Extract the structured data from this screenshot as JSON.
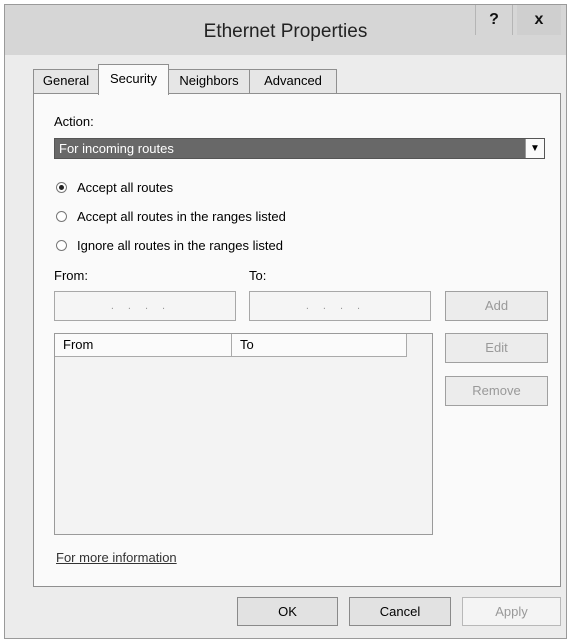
{
  "window": {
    "title": "Ethernet Properties",
    "help_glyph": "?",
    "close_glyph": "x"
  },
  "tabs": [
    {
      "label": "General"
    },
    {
      "label": "Security"
    },
    {
      "label": "Neighbors"
    },
    {
      "label": "Advanced"
    }
  ],
  "action": {
    "label": "Action:",
    "selected": "For incoming routes",
    "arrow_glyph": "▼"
  },
  "radios": [
    {
      "label": "Accept all routes",
      "checked": true
    },
    {
      "label": "Accept all routes in the ranges listed",
      "checked": false
    },
    {
      "label": "Ignore all routes in the ranges listed",
      "checked": false
    }
  ],
  "range": {
    "from_label": "From:",
    "to_label": "To:",
    "from_value": "....",
    "to_value": "....",
    "add_label": "Add",
    "edit_label": "Edit",
    "remove_label": "Remove"
  },
  "list": {
    "columns": [
      "From",
      "To"
    ]
  },
  "more_info": "For more information",
  "dialog_buttons": {
    "ok": "OK",
    "cancel": "Cancel",
    "apply": "Apply"
  },
  "colors": {
    "dropdown_bg": "#686868",
    "panel_bg": "#fafafa",
    "window_bg": "#ececec"
  }
}
